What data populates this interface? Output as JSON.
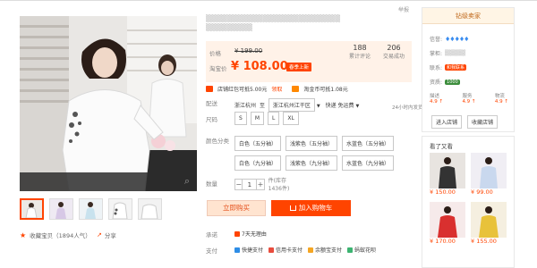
{
  "product": {
    "title_line1": "▒▒▒▒▒▒▒▒▒▒▒▒▒▒▒▒▒▒▒▒▒▒▒▒▒▒",
    "title_line2": "▒▒▒▒▒▒▒▒▒",
    "report_label": "举报"
  },
  "price": {
    "label_price": "价格",
    "original_price": "¥ 199.00",
    "label_promo": "淘宝价",
    "current_price": "¥ 108.00",
    "promo_tag": "春季上新",
    "stats": [
      {
        "num": "188",
        "label": "累计评论"
      },
      {
        "num": "206",
        "label": "交易成功"
      }
    ]
  },
  "coupons": {
    "coupon_text": "店铺红包可抵5.00元",
    "coupon_link": "领取",
    "points_text": "淘金币可抵1.08元"
  },
  "delivery": {
    "label": "配送",
    "from": "浙江杭州",
    "to_label": "至",
    "to": "浙江杭州江干区",
    "method": "快递 免运费",
    "note": "24小时内发货"
  },
  "size": {
    "label": "尺码",
    "options": [
      "S",
      "M",
      "L",
      "XL"
    ]
  },
  "colors": {
    "label": "颜色分类",
    "options": [
      "白色（五分袖）",
      "浅紫色（五分袖）",
      "水蓝色（五分袖）",
      "白色（九分袖）",
      "浅紫色（九分袖）",
      "水蓝色（九分袖）"
    ]
  },
  "quantity": {
    "label": "数量",
    "minus": "−",
    "value": "1",
    "plus": "+",
    "stock": "件(库存1436件)"
  },
  "actions": {
    "buy_now": "立即购买",
    "add_cart": "加入购物车"
  },
  "promise": {
    "label": "承诺",
    "text": "7天无理由"
  },
  "payment": {
    "label": "支付",
    "methods": [
      {
        "text": "快捷支付",
        "color": "#2e8de6"
      },
      {
        "text": "信用卡支付",
        "color": "#e84c3d"
      },
      {
        "text": "余额宝支付",
        "color": "#f5a623"
      },
      {
        "text": "蚂蚁花呗",
        "color": "#3cb371"
      }
    ]
  },
  "gallery": {
    "collect_text": "收藏宝贝（1894人气）",
    "share_text": "分享"
  },
  "shop": {
    "header": "钻级卖家",
    "credit_label": "信誉:",
    "credit_icon": "♦♦♦♦♦",
    "company_label": "掌柜:",
    "company_value": "▒▒▒▒▒",
    "contact_label": "联系:",
    "contact_badge": "和我联系",
    "deposit_label": "资质:",
    "deposit_badge": "1000",
    "scores": [
      {
        "label": "描述",
        "value": "4.9 ↑"
      },
      {
        "label": "服务",
        "value": "4.9 ↑"
      },
      {
        "label": "物流",
        "value": "4.9 ↑"
      }
    ],
    "enter_shop": "进入店铺",
    "collect_shop": "收藏店铺"
  },
  "related": {
    "header": "看了又看",
    "items": [
      {
        "price": "¥ 150.00"
      },
      {
        "price": "¥ 99.00"
      },
      {
        "price": "¥ 170.00"
      },
      {
        "price": "¥ 155.00"
      }
    ]
  },
  "colors_theme": {
    "accent": "#ff4400",
    "price_bg": "#fff2e8"
  }
}
